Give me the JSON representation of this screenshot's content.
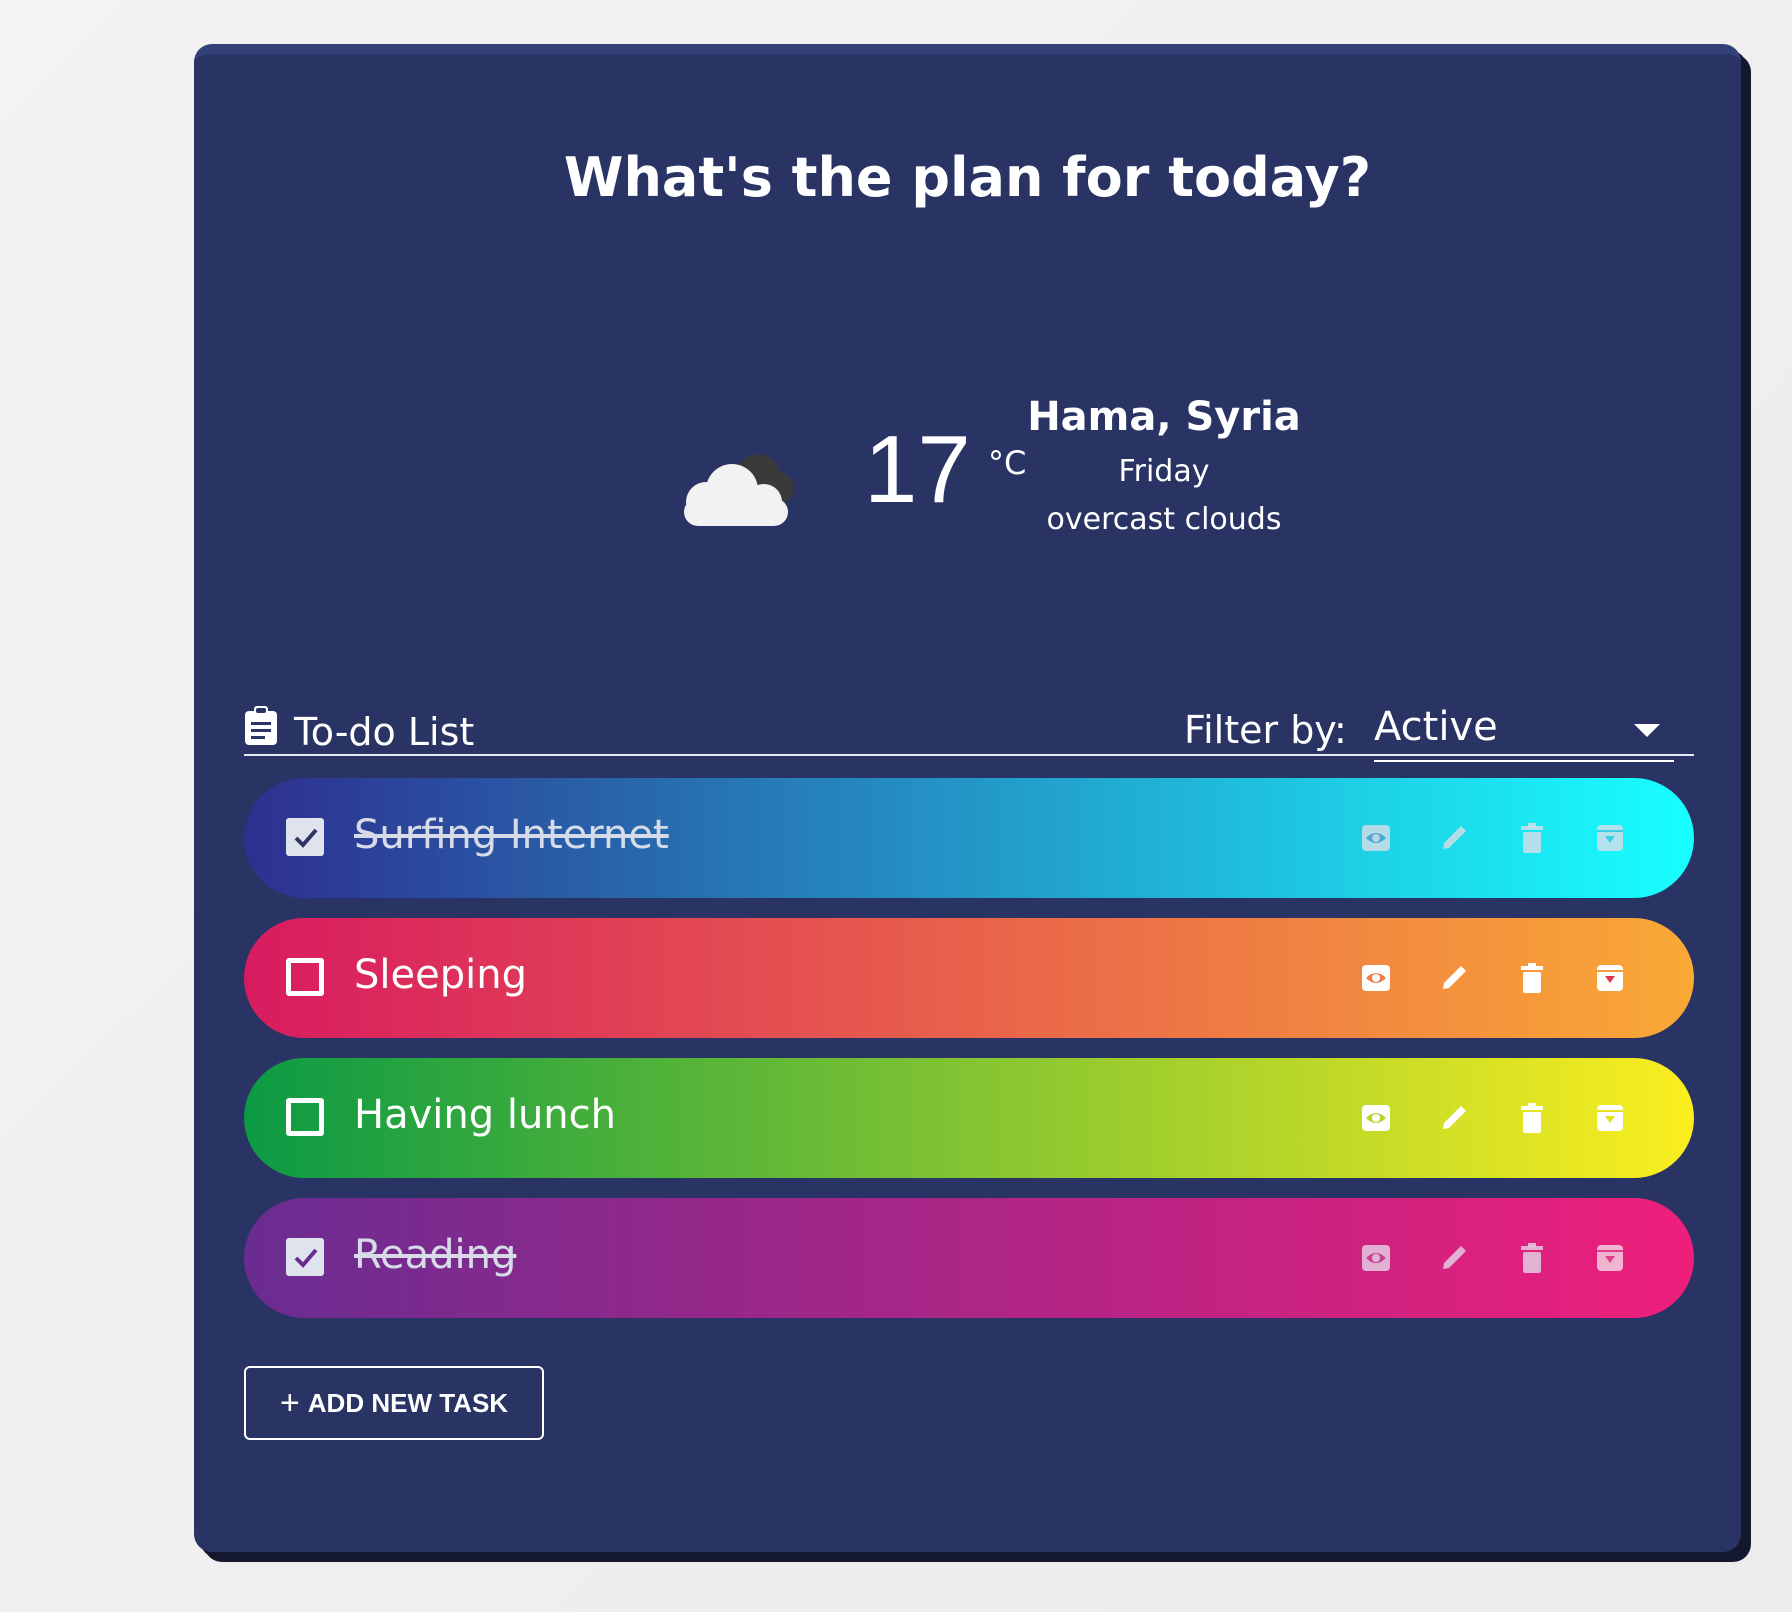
{
  "page": {
    "title": "What's the plan for today?"
  },
  "weather": {
    "icon": "cloud-icon",
    "temperature": "17",
    "unit": "°C",
    "city": "Hama, Syria",
    "day": "Friday",
    "description": "overcast clouds"
  },
  "todo": {
    "header_icon": "clipboard-icon",
    "title": "To-do List",
    "filter_label": "Filter by:",
    "filter_value": "Active"
  },
  "tasks": [
    {
      "label": "Surfing Internet",
      "done": true,
      "gradient": [
        "#2e2f8f",
        "#18ffff"
      ]
    },
    {
      "label": "Sleeping",
      "done": false,
      "gradient": [
        "#d81b60",
        "#f9a936"
      ]
    },
    {
      "label": "Having lunch",
      "done": false,
      "gradient": [
        "#0b9a44",
        "#fbee1f"
      ]
    },
    {
      "label": "Reading",
      "done": true,
      "gradient": [
        "#6a2c91",
        "#ee1f7b"
      ]
    }
  ],
  "actions": [
    "eye-icon",
    "pencil-icon",
    "trash-icon",
    "archive-icon"
  ],
  "add_button": {
    "label": "ADD NEW TASK"
  },
  "colors": {
    "card": "#293364",
    "text": "#ffffff"
  }
}
